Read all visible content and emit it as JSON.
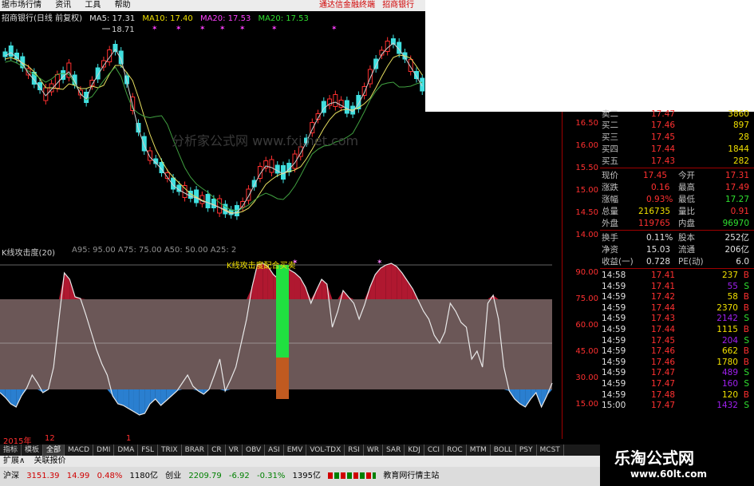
{
  "menu": {
    "items": [
      "据市场行情",
      "资讯",
      "工具",
      "帮助"
    ],
    "right_items": [
      "通达信金融终端",
      "招商银行"
    ]
  },
  "chart_header": {
    "title": "招商银行(日线 前复权)",
    "ma5": "MA5: 17.31",
    "ma10": "MA10: 17.40",
    "ma20a": "MA20: 17.53",
    "ma20b": "MA20: 17.53",
    "high_label": "18.71"
  },
  "main_yaxis": [
    "16.50",
    "16.00",
    "15.50",
    "15.00",
    "14.50",
    "14.00"
  ],
  "overlay_text": "分析家公式网 www.fxj.net.com",
  "indicator": {
    "title": "K线攻击度(20)",
    "params": "A95: 95.00  A75: 75.00  A50: 50.00  A25: 2",
    "label": "K线攻击度配合买卖",
    "yaxis": [
      "90.00",
      "75.00",
      "60.00",
      "45.00",
      "30.00",
      "15.00"
    ]
  },
  "quote": {
    "asks": [
      {
        "label": "卖二",
        "price": "17.47",
        "vol": "3860"
      },
      {
        "label": "买二",
        "price": "17.46",
        "vol": "897"
      },
      {
        "label": "买三",
        "price": "17.45",
        "vol": "28"
      },
      {
        "label": "买四",
        "price": "17.44",
        "vol": "1844"
      },
      {
        "label": "买五",
        "price": "17.43",
        "vol": "282"
      }
    ],
    "stats": [
      {
        "l1": "现价",
        "v1": "17.45",
        "l2": "今开",
        "v2": "17.31"
      },
      {
        "l1": "涨跌",
        "v1": "0.16",
        "l2": "最高",
        "v2": "17.49"
      },
      {
        "l1": "涨幅",
        "v1": "0.93%",
        "l2": "最低",
        "v2": "17.27"
      },
      {
        "l1": "总量",
        "v1": "216735",
        "l2": "量比",
        "v2": "0.91"
      },
      {
        "l1": "外盘",
        "v1": "119765",
        "l2": "内盘",
        "v2": "96970"
      }
    ],
    "fund": [
      {
        "l1": "换手",
        "v1": "0.11%",
        "l2": "股本",
        "v2": "252亿"
      },
      {
        "l1": "净资",
        "v1": "15.03",
        "l2": "流通",
        "v2": "206亿"
      },
      {
        "l1": "收益(一)",
        "v1": "0.728",
        "l2": "PE(动)",
        "v2": "6.0"
      }
    ],
    "trades": [
      {
        "t": "14:58",
        "p": "17.41",
        "v": "237",
        "s": "B"
      },
      {
        "t": "14:59",
        "p": "17.41",
        "v": "55",
        "s": "S"
      },
      {
        "t": "14:59",
        "p": "17.42",
        "v": "58",
        "s": "B"
      },
      {
        "t": "14:59",
        "p": "17.44",
        "v": "2370",
        "s": "B"
      },
      {
        "t": "14:59",
        "p": "17.43",
        "v": "2142",
        "s": "S"
      },
      {
        "t": "14:59",
        "p": "17.44",
        "v": "1115",
        "s": "B"
      },
      {
        "t": "14:59",
        "p": "17.45",
        "v": "204",
        "s": "S"
      },
      {
        "t": "14:59",
        "p": "17.46",
        "v": "662",
        "s": "B"
      },
      {
        "t": "14:59",
        "p": "17.46",
        "v": "1780",
        "s": "B"
      },
      {
        "t": "14:59",
        "p": "17.47",
        "v": "489",
        "s": "S"
      },
      {
        "t": "14:59",
        "p": "17.47",
        "v": "160",
        "s": "S"
      },
      {
        "t": "14:59",
        "p": "17.48",
        "v": "120",
        "s": "B"
      },
      {
        "t": "15:00",
        "p": "17.47",
        "v": "1432",
        "s": "S"
      }
    ]
  },
  "date_row": {
    "year": "2015年",
    "m1": "12",
    "m2": "1"
  },
  "tabs": [
    "指标",
    "模板",
    "全部",
    "MACD",
    "DMI",
    "DMA",
    "FSL",
    "TRIX",
    "BRAR",
    "CR",
    "VR",
    "OBV",
    "ASI",
    "EMV",
    "VOL-TDX",
    "RSI",
    "WR",
    "SAR",
    "KDJ",
    "CCI",
    "ROC",
    "MTM",
    "BOLL",
    "PSY",
    "MCST"
  ],
  "subtabs": [
    "扩展∧",
    "关联报价"
  ],
  "status": {
    "sh_label": "沪深",
    "sh_val": "3151.39",
    "sh_chg": "14.99",
    "sh_pct": "0.48%",
    "sh_amt": "1180亿",
    "cy_label": "创业",
    "cy_val": "2209.79",
    "cy_chg": "-6.92",
    "cy_pct": "-0.31%",
    "cy_amt": "1395亿",
    "site": "教育网行情主站"
  },
  "watermark": {
    "line1": "乐淘公式网",
    "line2": "www.60lt.com"
  },
  "colors": {
    "up": "#ff3030",
    "down": "#40e0e0",
    "fill_red": "#b01830",
    "fill_blue": "#2a7fd0",
    "band": "#6b5757"
  }
}
